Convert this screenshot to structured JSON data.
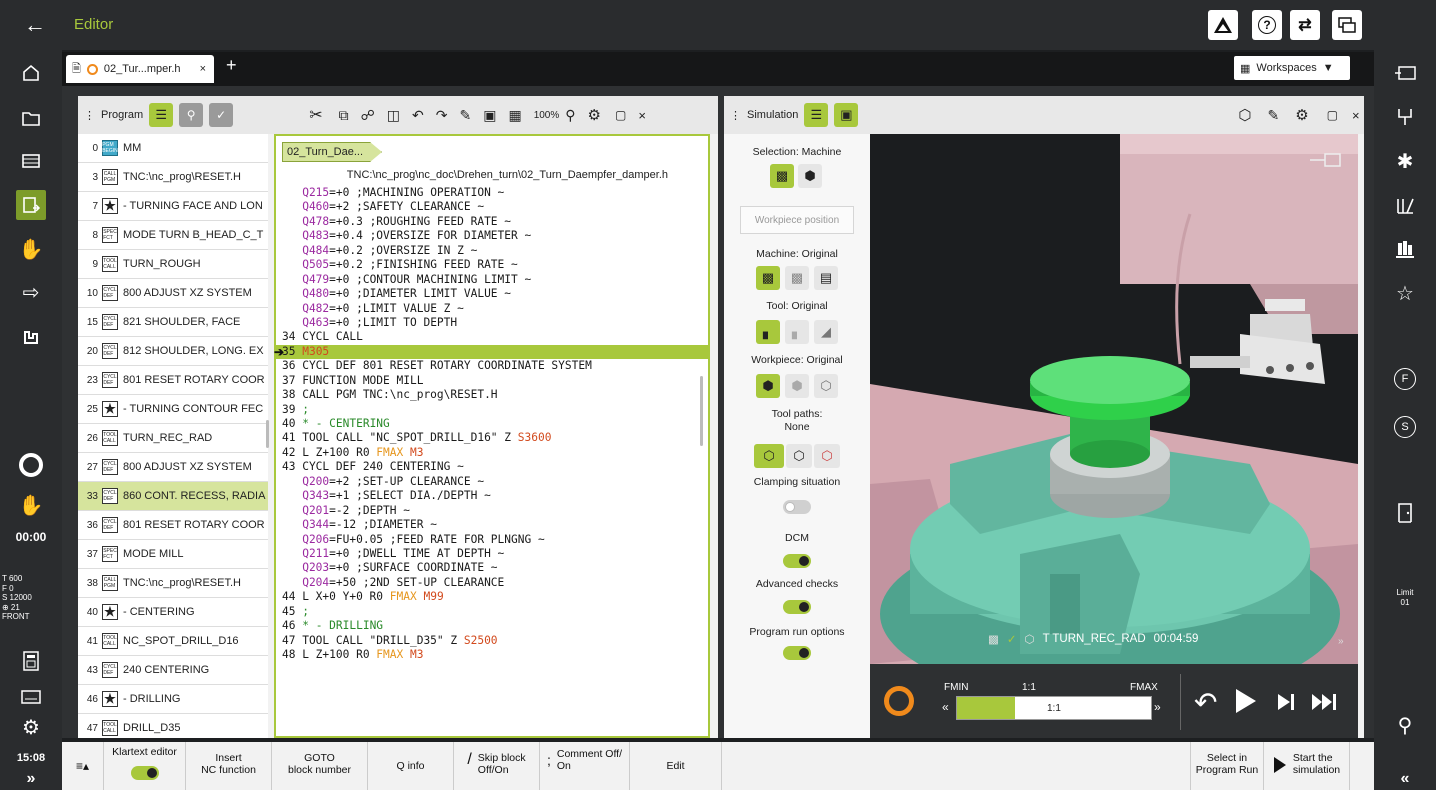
{
  "topbar": {
    "title": "Editor",
    "icons": [
      "warning-triangle-icon",
      "help-icon",
      "switch-icon",
      "windows-icon"
    ]
  },
  "tabbar": {
    "file_tab": "02_Tur...mper.h",
    "add_label": "+",
    "workspaces": "Workspaces"
  },
  "left_sidebar": {
    "timer": "00:00",
    "status_lines": [
      "T   600",
      "F     0",
      "S 12000",
      "⊕   21",
      "FRONT"
    ],
    "clock": "15:08",
    "expand": "»"
  },
  "right_sidebar": {
    "limit_label": "Limit",
    "limit_value": "01",
    "collapse": "«"
  },
  "program": {
    "title": "Program",
    "zoom": "100%",
    "blocks": [
      {
        "num": "0",
        "badge": "PGM\nBEGIN",
        "text": "MM",
        "type": "pgm"
      },
      {
        "num": "3",
        "badge": "CALL\nPGM",
        "text": "TNC:\\nc_prog\\RESET.H"
      },
      {
        "num": "7",
        "badge": "★",
        "text": "- TURNING FACE AND LON",
        "type": "star"
      },
      {
        "num": "8",
        "badge": "SPEC\nFCT",
        "text": "MODE TURN B_HEAD_C_T"
      },
      {
        "num": "9",
        "badge": "TOOL\nCALL",
        "text": "TURN_ROUGH"
      },
      {
        "num": "10",
        "badge": "CYCL\nDEF",
        "text": "800 ADJUST XZ SYSTEM"
      },
      {
        "num": "15",
        "badge": "CYCL\nDEF",
        "text": "821 SHOULDER, FACE"
      },
      {
        "num": "20",
        "badge": "CYCL\nDEF",
        "text": "812 SHOULDER, LONG. EX"
      },
      {
        "num": "23",
        "badge": "CYCL\nDEF",
        "text": "801 RESET ROTARY COOR"
      },
      {
        "num": "25",
        "badge": "★",
        "text": "- TURNING CONTOUR FEC",
        "type": "star"
      },
      {
        "num": "26",
        "badge": "TOOL\nCALL",
        "text": "TURN_REC_RAD"
      },
      {
        "num": "27",
        "badge": "CYCL\nDEF",
        "text": "800 ADJUST XZ SYSTEM"
      },
      {
        "num": "33",
        "badge": "CYCL\nDEF",
        "text": "860 CONT. RECESS, RADIA",
        "sel": true
      },
      {
        "num": "36",
        "badge": "CYCL\nDEF",
        "text": "801 RESET ROTARY COOR"
      },
      {
        "num": "37",
        "badge": "SPEC\nFCT",
        "text": "MODE MILL"
      },
      {
        "num": "38",
        "badge": "CALL\nPGM",
        "text": "TNC:\\nc_prog\\RESET.H"
      },
      {
        "num": "40",
        "badge": "★",
        "text": "- CENTERING",
        "type": "star"
      },
      {
        "num": "41",
        "badge": "TOOL\nCALL",
        "text": "NC_SPOT_DRILL_D16"
      },
      {
        "num": "43",
        "badge": "CYCL\nDEF",
        "text": "240 CENTERING"
      },
      {
        "num": "46",
        "badge": "★",
        "text": "- DRILLING",
        "type": "star"
      },
      {
        "num": "47",
        "badge": "TOOL\nCALL",
        "text": "DRILL_D35"
      }
    ],
    "breadcrumb": "02_Turn_Dae...",
    "path": "TNC:\\nc_prog\\nc_doc\\Drehen_turn\\02_Turn_Daempfer_damper.h",
    "code": [
      [
        [
          "q",
          "   Q215"
        ],
        [
          "dk",
          "=+0 ;MACHINING OPERATION ~"
        ]
      ],
      [
        [
          "q",
          "   Q460"
        ],
        [
          "dk",
          "=+2 ;SAFETY CLEARANCE ~"
        ]
      ],
      [
        [
          "q",
          "   Q478"
        ],
        [
          "dk",
          "=+0.3 ;ROUGHING FEED RATE ~"
        ]
      ],
      [
        [
          "q",
          "   Q483"
        ],
        [
          "dk",
          "=+0.4 ;OVERSIZE FOR DIAMETER ~"
        ]
      ],
      [
        [
          "q",
          "   Q484"
        ],
        [
          "dk",
          "=+0.2 ;OVERSIZE IN Z ~"
        ]
      ],
      [
        [
          "q",
          "   Q505"
        ],
        [
          "dk",
          "=+0.2 ;FINISHING FEED RATE ~"
        ]
      ],
      [
        [
          "q",
          "   Q479"
        ],
        [
          "dk",
          "=+0 ;CONTOUR MACHINING LIMIT ~"
        ]
      ],
      [
        [
          "q",
          "   Q480"
        ],
        [
          "dk",
          "=+0 ;DIAMETER LIMIT VALUE ~"
        ]
      ],
      [
        [
          "q",
          "   Q482"
        ],
        [
          "dk",
          "=+0 ;LIMIT VALUE Z ~"
        ]
      ],
      [
        [
          "q",
          "   Q463"
        ],
        [
          "dk",
          "=+0 ;LIMIT TO DEPTH"
        ]
      ],
      [
        [
          "dk",
          "34 CYCL CALL"
        ]
      ],
      [
        [
          "dk",
          "35 "
        ],
        [
          "r",
          "M305"
        ]
      ],
      [
        [
          "dk",
          "36 CYCL DEF 801 RESET ROTARY COORDINATE SYSTEM"
        ]
      ],
      [
        [
          "dk",
          "37 FUNCTION MODE MILL"
        ]
      ],
      [
        [
          "dk",
          "38 CALL PGM TNC:\\nc_prog\\RESET.H"
        ]
      ],
      [
        [
          "dk",
          "39 "
        ],
        [
          "g",
          ";"
        ]
      ],
      [
        [
          "dk",
          "40 "
        ],
        [
          "g",
          "* - CENTERING"
        ]
      ],
      [
        [
          "dk",
          "41 TOOL CALL \"NC_SPOT_DRILL_D16\" Z "
        ],
        [
          "r",
          "S3600"
        ]
      ],
      [
        [
          "dk",
          "42 L Z+100 R0 "
        ],
        [
          "o",
          "FMAX"
        ],
        [
          "dk",
          " "
        ],
        [
          "r",
          "M3"
        ]
      ],
      [
        [
          "dk",
          "43 CYCL DEF 240 CENTERING ~"
        ]
      ],
      [
        [
          "q",
          "   Q200"
        ],
        [
          "dk",
          "=+2 ;SET-UP CLEARANCE ~"
        ]
      ],
      [
        [
          "q",
          "   Q343"
        ],
        [
          "dk",
          "=+1 ;SELECT DIA./DEPTH ~"
        ]
      ],
      [
        [
          "q",
          "   Q201"
        ],
        [
          "dk",
          "=-2 ;DEPTH ~"
        ]
      ],
      [
        [
          "q",
          "   Q344"
        ],
        [
          "dk",
          "=-12 ;DIAMETER ~"
        ]
      ],
      [
        [
          "q",
          "   Q206"
        ],
        [
          "dk",
          "=FU+0.05 ;FEED RATE FOR PLNGNG ~"
        ]
      ],
      [
        [
          "q",
          "   Q211"
        ],
        [
          "dk",
          "=+0 ;DWELL TIME AT DEPTH ~"
        ]
      ],
      [
        [
          "q",
          "   Q203"
        ],
        [
          "dk",
          "=+0 ;SURFACE COORDINATE ~"
        ]
      ],
      [
        [
          "q",
          "   Q204"
        ],
        [
          "dk",
          "=+50 ;2ND SET-UP CLEARANCE"
        ]
      ],
      [
        [
          "dk",
          "44 L X+0 Y+0 R0 "
        ],
        [
          "o",
          "FMAX"
        ],
        [
          "dk",
          " "
        ],
        [
          "r",
          "M99"
        ]
      ],
      [
        [
          "dk",
          "45 "
        ],
        [
          "g",
          ";"
        ]
      ],
      [
        [
          "dk",
          "46 "
        ],
        [
          "g",
          "* - DRILLING"
        ]
      ],
      [
        [
          "dk",
          "47 TOOL CALL \"DRILL_D35\" Z "
        ],
        [
          "r",
          "S2500"
        ]
      ],
      [
        [
          "dk",
          "48 L Z+100 R0 "
        ],
        [
          "o",
          "FMAX"
        ],
        [
          "dk",
          " "
        ],
        [
          "r",
          "M3"
        ]
      ]
    ]
  },
  "simulation": {
    "title": "Simulation",
    "selection_label": "Selection: Machine",
    "workpiece_position": "Workpiece position",
    "machine_label": "Machine: Original",
    "tool_label": "Tool: Original",
    "workpiece_label": "Workpiece: Original",
    "toolpaths_label": "Tool paths:",
    "toolpaths_value": "None",
    "clamping_label": "Clamping situation",
    "clamping_on": false,
    "dcm_label": "DCM",
    "dcm_on": true,
    "advanced_label": "Advanced checks",
    "advanced_on": true,
    "runopts_label": "Program run options",
    "runopts_on": true,
    "status_tool": "T TURN_REC_RAD",
    "status_time": "00:04:59",
    "fmin": "FMIN",
    "ratio": "1:1",
    "fmax": "FMAX",
    "speed_value": "1:1",
    "speed_fraction": 0.3,
    "colors": {
      "accent": "#a8c83c",
      "panel": "#2e3032",
      "machine": "#d3aab2",
      "fixture": "#5fb8a1",
      "part": "#2fd04a"
    }
  },
  "bottom": {
    "klartext_label": "Klartext editor",
    "klartext_on": true,
    "insert_l1": "Insert",
    "insert_l2": "NC function",
    "goto_l1": "GOTO",
    "goto_l2": "block number",
    "qinfo": "Q info",
    "skip_l1": "Skip block",
    "skip_l2": "Off/On",
    "comment_l1": "Comment Off/",
    "comment_l2": "On",
    "edit": "Edit",
    "select_l1": "Select in",
    "select_l2": "Program Run",
    "start_l1": "Start the",
    "start_l2": "simulation"
  }
}
